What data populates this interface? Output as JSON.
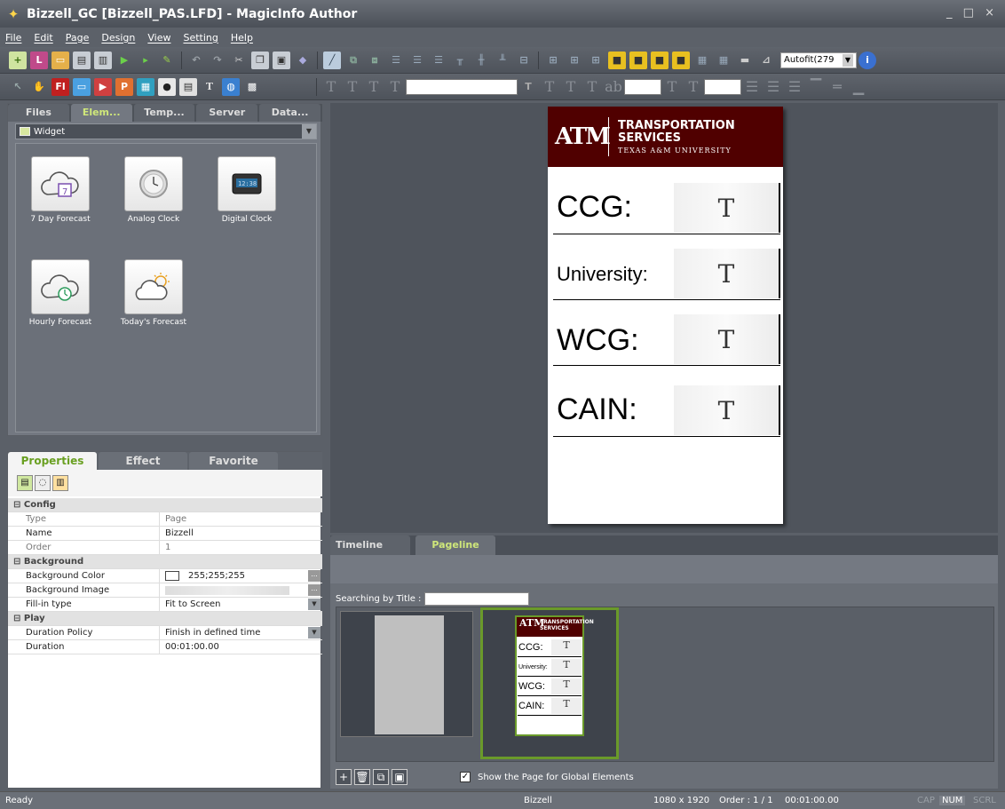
{
  "window": {
    "title": "Bizzell_GC [Bizzell_PAS.LFD] - MagicInfo Author",
    "controls": "_ □ ×"
  },
  "menu": [
    "File",
    "Edit",
    "Page",
    "Design",
    "View",
    "Setting",
    "Help"
  ],
  "toolbar": {
    "autofit_value": "Autofit(279",
    "icons_row1": [
      "new-icon",
      "new-lfd-icon",
      "open-icon",
      "save-icon",
      "save-as-icon",
      "play-icon",
      "play-page-icon",
      "publish-icon",
      "undo-icon",
      "redo-icon",
      "cut-icon",
      "copy-icon",
      "paste-icon",
      "fill-icon",
      "line-icon",
      "bring-front-icon",
      "send-back-icon",
      "align-left-icon",
      "align-center-icon",
      "align-right-icon",
      "align-top-icon",
      "align-middle-icon",
      "align-bottom-icon",
      "distribute-icon",
      "same-size-icon",
      "same-width-icon",
      "same-height-icon",
      "group-icon",
      "ungroup-icon",
      "lock-icon",
      "unlock-icon",
      "grid-icon",
      "snap-icon",
      "ruler-icon",
      "guide-icon",
      "info-icon"
    ],
    "icons_row2": [
      "pointer-icon",
      "hand-icon",
      "flash-icon",
      "image-icon",
      "video-icon",
      "powerpoint-icon",
      "office-icon",
      "media-icon",
      "table-icon",
      "text-icon",
      "web-icon",
      "clapper-icon"
    ]
  },
  "left_panel": {
    "tabs": [
      "Files",
      "Elem...",
      "Temp...",
      "Server",
      "Data..."
    ],
    "active_tab": "Elem...",
    "category": "Widget",
    "widgets": [
      {
        "label": "7 Day Forecast",
        "icon": "seven-day-forecast-icon"
      },
      {
        "label": "Analog Clock",
        "icon": "analog-clock-icon"
      },
      {
        "label": "Digital Clock",
        "icon": "digital-clock-icon"
      },
      {
        "label": "Hourly Forecast",
        "icon": "hourly-forecast-icon"
      },
      {
        "label": "Today's Forecast",
        "icon": "todays-forecast-icon"
      }
    ]
  },
  "properties": {
    "tabs": [
      "Properties",
      "Effect",
      "Favorite"
    ],
    "active_tab": "Properties",
    "groups": {
      "config": "Config",
      "background": "Background",
      "play": "Play"
    },
    "rows": {
      "type": {
        "key": "Type",
        "value": "Page"
      },
      "name": {
        "key": "Name",
        "value": "Bizzell"
      },
      "order": {
        "key": "Order",
        "value": "1"
      },
      "bg_color": {
        "key": "Background Color",
        "value": "255;255;255"
      },
      "bg_image": {
        "key": "Background Image",
        "value": ""
      },
      "fill_type": {
        "key": "Fill-in type",
        "value": "Fit to Screen"
      },
      "duration_policy": {
        "key": "Duration Policy",
        "value": "Finish in defined time"
      },
      "duration": {
        "key": "Duration",
        "value": "00:01:00.00"
      }
    },
    "ellipsis": "...",
    "collapse": "⊟"
  },
  "canvas": {
    "logo": {
      "mark": "ATM",
      "line1": "TRANSPORTATION",
      "line2": "SERVICES",
      "line3": "TEXAS A&M UNIVERSITY"
    },
    "rows": [
      {
        "label": "CCG:",
        "tile": "T"
      },
      {
        "label": "University:",
        "tile": "T"
      },
      {
        "label": "WCG:",
        "tile": "T"
      },
      {
        "label": "CAIN:",
        "tile": "T"
      }
    ]
  },
  "timeline": {
    "tabs": [
      "Timeline",
      "Pageline"
    ],
    "active_tab": "Pageline",
    "search_label": "Searching by Title :",
    "global_checkbox_label": "Show the Page for Global Elements",
    "mini_rows": [
      {
        "label": "CCG:",
        "tile": "T"
      },
      {
        "label": "University:",
        "tile": "T"
      },
      {
        "label": "WCG:",
        "tile": "T"
      },
      {
        "label": "CAIN:",
        "tile": "T"
      }
    ],
    "mini_logo_line1": "TRANSPORTATION",
    "mini_logo_line2": "SERVICES"
  },
  "status": {
    "left": "Ready",
    "page": "Bizzell",
    "resolution": "1080 x 1920",
    "order": "Order : 1 / 1",
    "time": "00:01:00.00",
    "cap": "CAP",
    "num": "NUM",
    "scrl": "SCRL"
  },
  "colors": {
    "brand_maroon": "#500000",
    "accent_green": "#6a9a2a",
    "active_tab": "#cfe77a"
  }
}
